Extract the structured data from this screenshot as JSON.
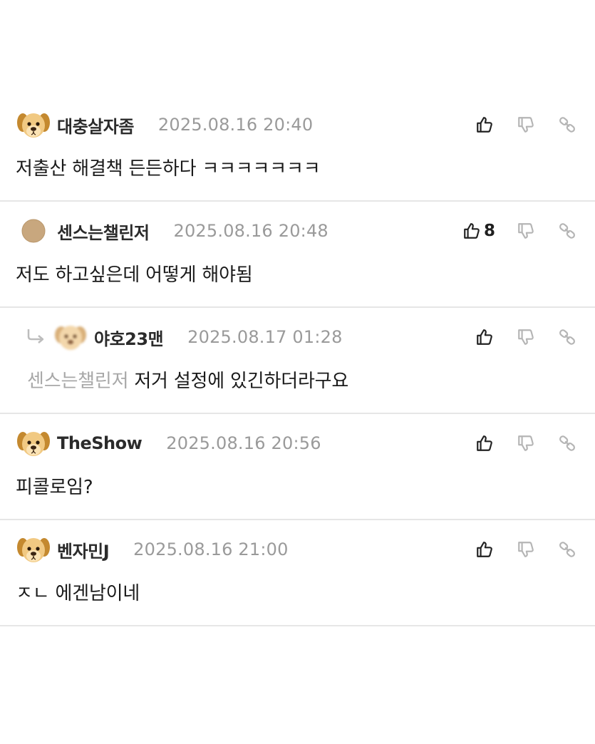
{
  "comments": [
    {
      "author": "대충살자좀",
      "date": "2025.08.16 20:40",
      "avatar": "puppy-avatar",
      "text": "저출산 해결책 든든하다 ㅋㅋㅋㅋㅋㅋㅋ",
      "like_count": ""
    },
    {
      "author": "센스는챌린저",
      "date": "2025.08.16 20:48",
      "avatar": "default-avatar",
      "text": "저도 하고싶은데 어떻게 해야됨",
      "like_count": "8"
    },
    {
      "author": "야호23맨",
      "date": "2025.08.17 01:28",
      "avatar": "blurred-puppy-avatar",
      "mention": "센스는챌린저",
      "text": "저거 설정에 있긴하더라구요",
      "like_count": "",
      "is_reply": true
    },
    {
      "author": "TheShow",
      "date": "2025.08.16 20:56",
      "avatar": "puppy-avatar",
      "text": "피콜로임?",
      "like_count": ""
    },
    {
      "author": "벤자민J",
      "date": "2025.08.16 21:00",
      "avatar": "puppy-avatar",
      "text": "ㅈㄴ 에겐남이네",
      "like_count": ""
    }
  ],
  "icons": {
    "like": "thumbs-up-icon",
    "dislike": "thumbs-down-icon",
    "share": "link-icon",
    "reply": "reply-arrow-icon"
  },
  "colors": {
    "author": "#2b2b2b",
    "date": "#9a9a9a",
    "mention": "#a8a8a8",
    "divider": "#e6e6e6",
    "icon_active": "#222222",
    "icon_muted": "#b5b5b5"
  }
}
